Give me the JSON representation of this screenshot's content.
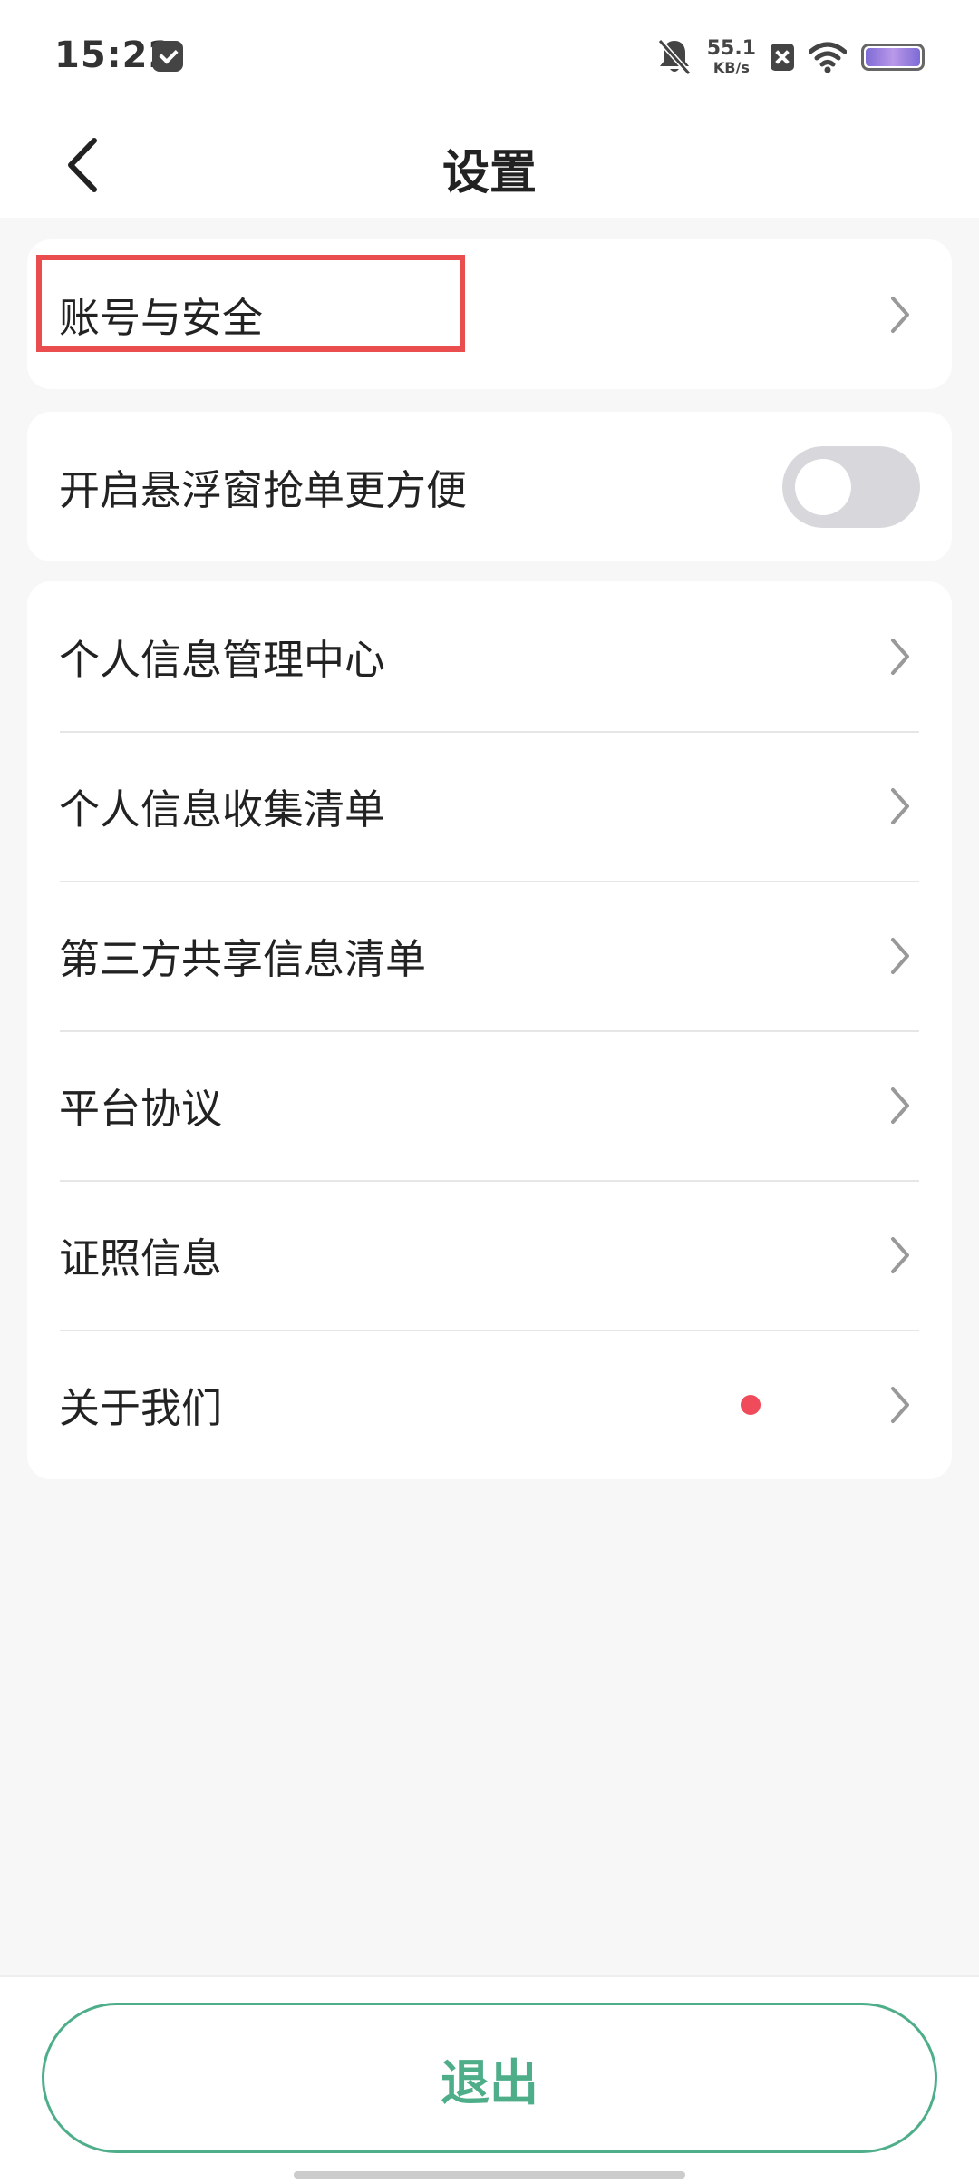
{
  "status_bar": {
    "time": "15:22",
    "net_speed_value": "55.1",
    "net_speed_unit": "KB/s"
  },
  "header": {
    "title": "设置"
  },
  "settings": {
    "account": {
      "label": "账号与安全"
    },
    "floating_window": {
      "label": "开启悬浮窗抢单更方便",
      "enabled": false
    },
    "items": [
      {
        "label": "个人信息管理中心"
      },
      {
        "label": "个人信息收集清单"
      },
      {
        "label": "第三方共享信息清单"
      },
      {
        "label": "平台协议"
      },
      {
        "label": "证照信息"
      },
      {
        "label": "关于我们",
        "has_badge": true
      }
    ]
  },
  "footer": {
    "logout_label": "退出"
  },
  "colors": {
    "accent": "#4fae8a",
    "badge": "#ef4b5b",
    "highlight": "#e94d4d",
    "toggle_off": "#d8d8dc",
    "background": "#f7f7f7"
  },
  "icons": [
    "back-arrow-icon",
    "chevron-right-icon",
    "mute-bell-icon",
    "wifi-icon",
    "battery-icon",
    "no-sim-icon"
  ]
}
